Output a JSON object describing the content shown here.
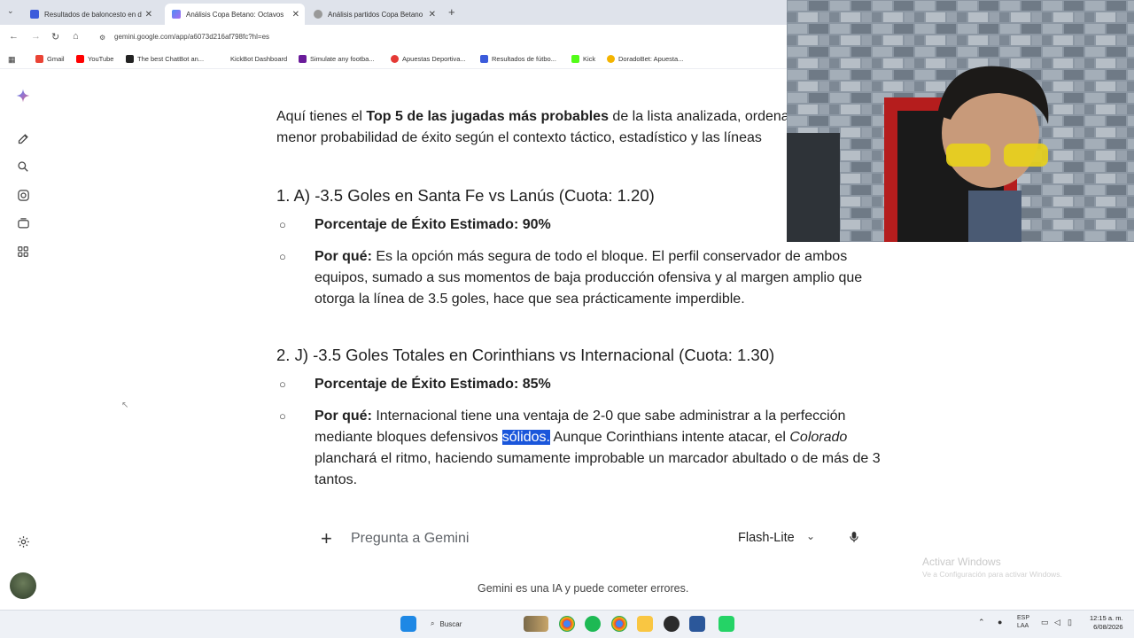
{
  "browser": {
    "tabs": [
      {
        "label": "Resultados de baloncesto en d",
        "active": false
      },
      {
        "label": "Análisis Copa Betano: Octavos",
        "active": true
      },
      {
        "label": "Análisis partidos Copa Betano",
        "active": false
      }
    ],
    "url": "gemini.google.com/app/a6073d216af798fc?hl=es",
    "bookmarks": [
      "Gmail",
      "YouTube",
      "The best ChatBot an...",
      "KickBot Dashboard",
      "Simulate any footba...",
      "Apuestas Deportiva...",
      "Resultados de fútbo...",
      "Kick",
      "DoradoBet: Apuesta..."
    ]
  },
  "sidebar": {
    "icons": [
      "gemini-sparkle-icon",
      "new-chat-icon",
      "search-icon",
      "gems-icon",
      "library-icon",
      "apps-icon",
      "settings-icon",
      "avatar"
    ]
  },
  "main": {
    "intro_prefix": "Aquí tienes el ",
    "intro_bold": "Top 5 de las jugadas más probables",
    "intro_rest": " de la lista analizada, ordena",
    "intro_line2": "menor probabilidad de éxito según el contexto táctico, estadístico y las líneas",
    "sections": [
      {
        "heading": "1. A) -3.5 Goles en Santa Fe vs Lanús (Cuota: 1.20)",
        "pct_label": "Porcentaje de Éxito Estimado: 90%",
        "why_label": "Por qué:",
        "why_text": " Es la opción más segura de todo el bloque. El perfil conservador de ambos equipos, sumado a sus momentos de baja producción ofensiva y al margen amplio que otorga la línea de 3.5 goles, hace que sea prácticamente imperdible."
      },
      {
        "heading": "2. J) -3.5 Goles Totales en Corinthians vs Internacional (Cuota: 1.30)",
        "pct_label": "Porcentaje de Éxito Estimado: 85%",
        "why_label": "Por qué:",
        "why_text_a": " Internacional tiene una ventaja de 2-0 que sabe administrar a la perfección mediante bloques defensivos ",
        "why_highlight": "sólidos.",
        "why_text_b": " Aunque Corinthians intente atacar, el ",
        "why_italic": "Colorado",
        "why_text_c": " planchará el ritmo, haciendo sumamente improbable un marcador abultado o de más de 3 tantos."
      }
    ]
  },
  "input": {
    "placeholder": "Pregunta a Gemini",
    "model": "Flash-Lite"
  },
  "footer": {
    "disclaimer": "Gemini es una IA y puede cometer errores."
  },
  "watermark": {
    "title": "Activar Windows",
    "subtitle": "Ve a Configuración para activar Windows."
  },
  "taskbar": {
    "search_label": "Buscar",
    "lang_top": "ESP",
    "lang_bottom": "LAA",
    "time": "12:15 a. m.",
    "date": "6/08/2026"
  },
  "colors": {
    "highlight": "#1a56db",
    "tab_bar": "#dfe3eb"
  }
}
